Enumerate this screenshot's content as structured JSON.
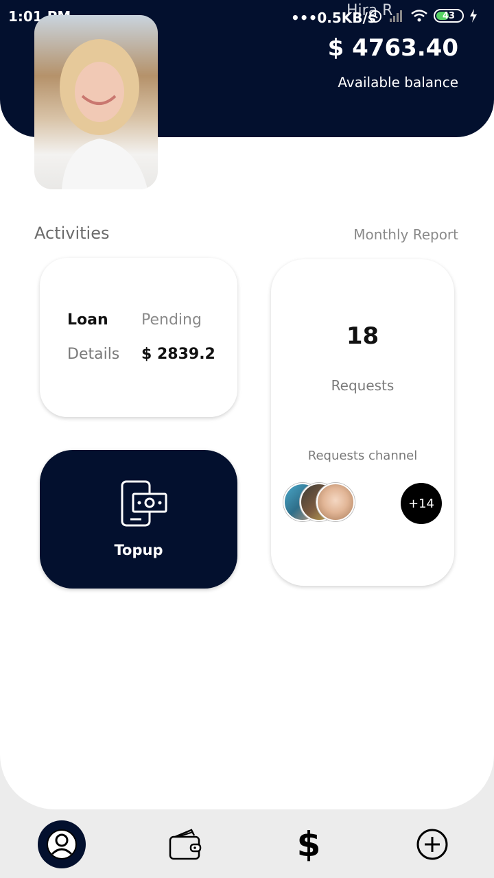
{
  "status_bar": {
    "time": "1:01 PM",
    "speed": "•••0.5KB/s",
    "name": "Hira R",
    "battery": "43"
  },
  "header": {
    "balance_amount": "$ 4763.40",
    "balance_label": "Available balance"
  },
  "activities": {
    "title": "Activities",
    "monthly_report": "Monthly Report"
  },
  "loan_card": {
    "key1": "Loan",
    "value1": "Pending",
    "key2": "Details",
    "value2": "$ 2839.2"
  },
  "topup": {
    "label": "Topup"
  },
  "requests": {
    "count": "18",
    "label": "Requests",
    "channel": "Requests channel",
    "more": "+14"
  },
  "icons": {
    "nav": [
      "profile-icon",
      "wallet-icon",
      "dollar-icon",
      "add-circle-icon"
    ]
  },
  "colors": {
    "primary": "#03102e",
    "background": "#ececec",
    "card": "#ffffff"
  }
}
